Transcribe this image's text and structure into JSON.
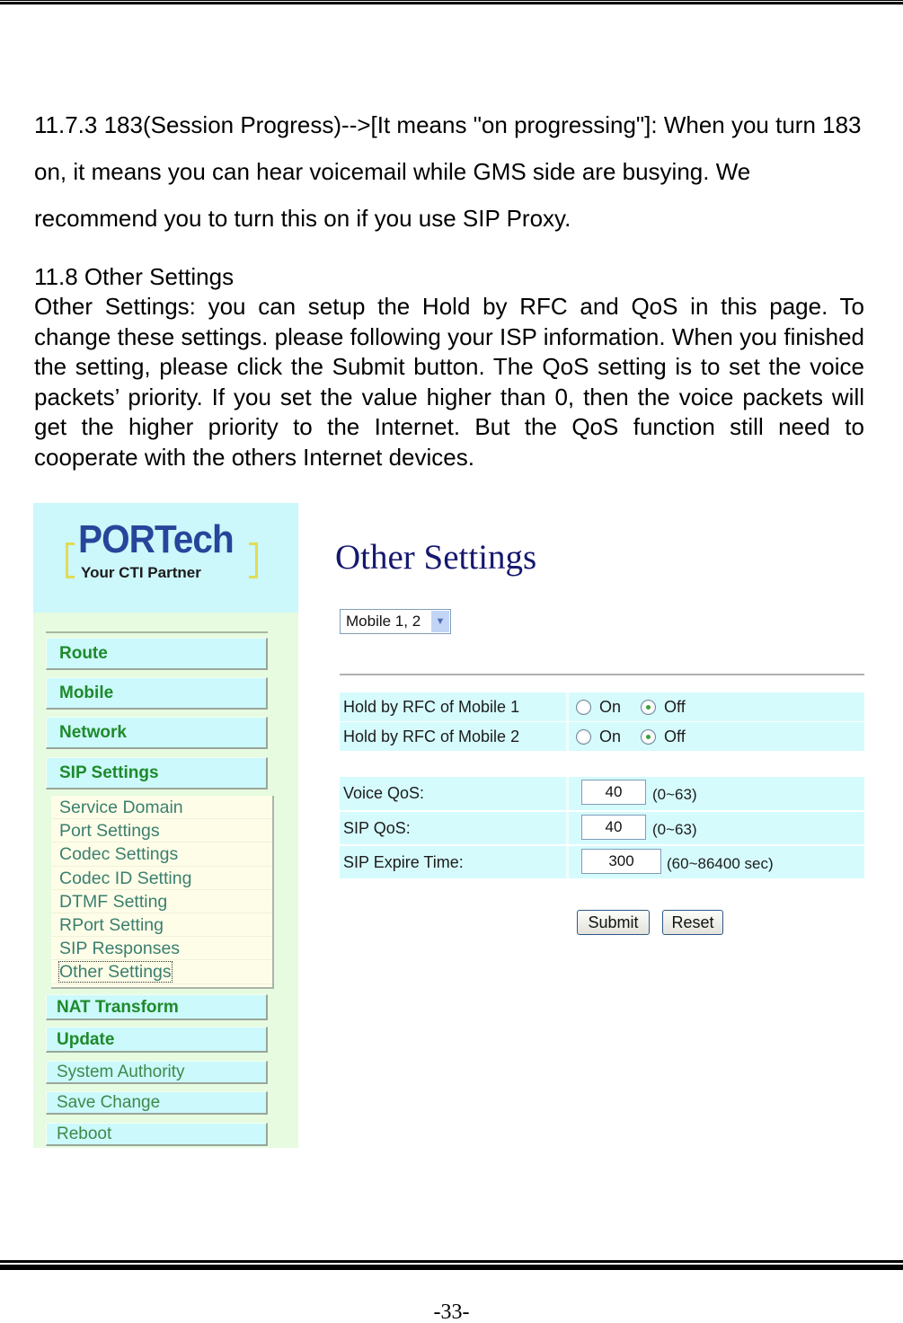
{
  "doc": {
    "section_1173": "11.7.3 183(Session Progress)-->[It means \"on progressing\"]: When you turn 183 on, it means you can hear voicemail while GMS side are busying.   We recommend you to turn this on if you use SIP Proxy.",
    "section_118_heading": "11.8 Other Settings",
    "section_118_body": "Other Settings: you can setup the Hold by RFC and QoS in this page. To change these settings. please following your ISP information. When you finished the setting, please click the Submit button. The QoS setting is to set the voice packets’ priority. If you set the value higher than 0, then the voice packets will get the higher priority to the Internet. But the QoS function still need to cooperate with the others Internet devices.",
    "page_number": "-33-"
  },
  "screenshot": {
    "logo": {
      "brand": "PORTech",
      "tagline": "Your CTI Partner"
    },
    "nav": {
      "route": "Route",
      "mobile": "Mobile",
      "network": "Network",
      "sip_settings": "SIP Settings",
      "sip_sub": [
        "Service Domain",
        "Port Settings",
        "Codec Settings",
        "Codec ID Setting",
        "DTMF Setting",
        "RPort Setting",
        "SIP Responses",
        "Other Settings"
      ],
      "active_sub": "Other Settings",
      "nat_transform": "NAT Transform",
      "update": "Update",
      "system_authority": "System Authority",
      "save_change": "Save Change",
      "reboot": "Reboot"
    },
    "main": {
      "title": "Other Settings",
      "mobile_select": {
        "value": "Mobile 1, 2",
        "arrow_icon": "chevron-down"
      },
      "hold_rows": [
        {
          "label": "Hold by RFC of Mobile 1",
          "on_label": "On",
          "off_label": "Off",
          "selected": "Off"
        },
        {
          "label": "Hold by RFC of Mobile 2",
          "on_label": "On",
          "off_label": "Off",
          "selected": "Off"
        }
      ],
      "qos_rows": [
        {
          "label": "Voice QoS:",
          "value": "40",
          "range": "(0~63)"
        },
        {
          "label": "SIP QoS:",
          "value": "40",
          "range": "(0~63)"
        },
        {
          "label": "SIP Expire Time:",
          "value": "300",
          "range": "(60~86400 sec)"
        }
      ],
      "submit_label": "Submit",
      "reset_label": "Reset"
    }
  }
}
